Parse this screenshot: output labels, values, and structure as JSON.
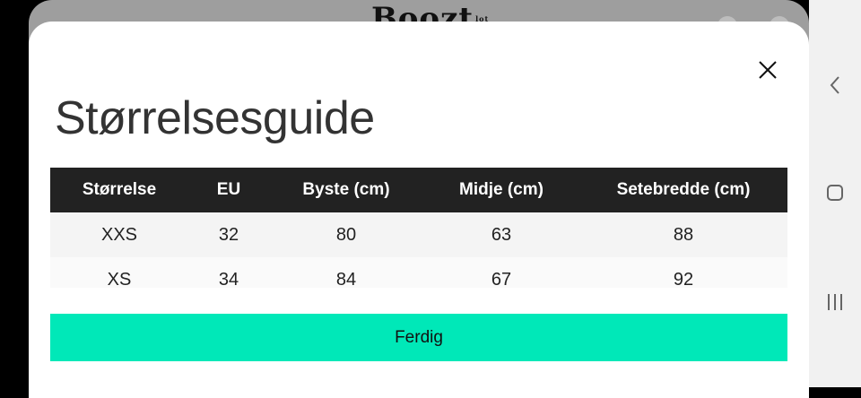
{
  "background": {
    "logo": "Boozt",
    "logo_mark": "lot"
  },
  "modal": {
    "title": "Størrelsesguide",
    "close_icon": "close-icon",
    "table": {
      "headers": [
        "Størrelse",
        "EU",
        "Byste (cm)",
        "Midje (cm)",
        "Setebredde (cm)"
      ],
      "rows": [
        [
          "XXS",
          "32",
          "80",
          "63",
          "88"
        ],
        [
          "XS",
          "34",
          "84",
          "67",
          "92"
        ]
      ]
    },
    "done_label": "Ferdig",
    "accent_color": "#00e8b8"
  },
  "navbar": {
    "icons": [
      "back-icon",
      "home-icon",
      "recents-icon"
    ]
  }
}
